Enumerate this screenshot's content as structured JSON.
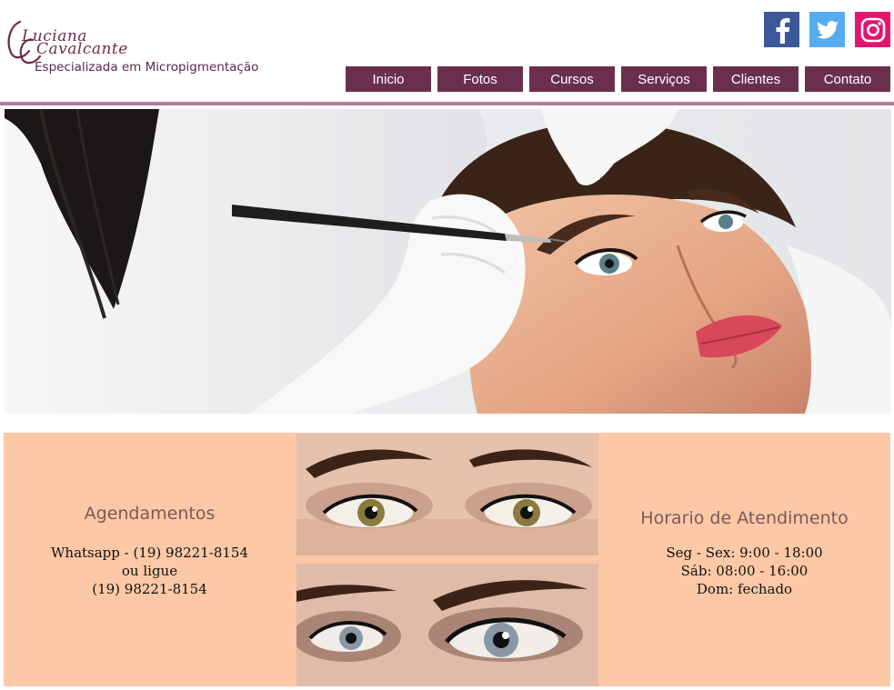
{
  "brand": {
    "name_line1": "Luciana",
    "name_line2": "Cavalcante",
    "tagline": "Especializada em Micropigmentação",
    "color": "#6b2b4a"
  },
  "social": [
    {
      "icon": "facebook-icon",
      "color": "#3b5998"
    },
    {
      "icon": "twitter-icon",
      "color": "#55acee"
    },
    {
      "icon": "instagram-icon",
      "color": "#e4146f"
    }
  ],
  "nav": {
    "items": [
      "Inicio",
      "Fotos",
      "Cursos",
      "Serviços",
      "Clientes",
      "Contato"
    ],
    "color": "#6b2f4e"
  },
  "hero": {
    "image": "microblading-eyebrow-procedure-photo"
  },
  "scheduling": {
    "title": "Agendamentos",
    "line1": "Whatsapp - (19) 98221-8154",
    "line2": "ou ligue",
    "line3": "(19) 98221-8154"
  },
  "hours": {
    "title": "Horario de Atendimento",
    "line1": "Seg - Sex: 9:00 - 18:00",
    "line2": "Sáb: 08:00 - 16:00",
    "line3": "Dom: fechado"
  },
  "gallery": {
    "top": "green-eyes-makeup-photo",
    "bottom": "blue-eye-makeup-photo"
  },
  "colors": {
    "accent_line": "#b07c97",
    "info_bg": "#fcc8a6"
  }
}
